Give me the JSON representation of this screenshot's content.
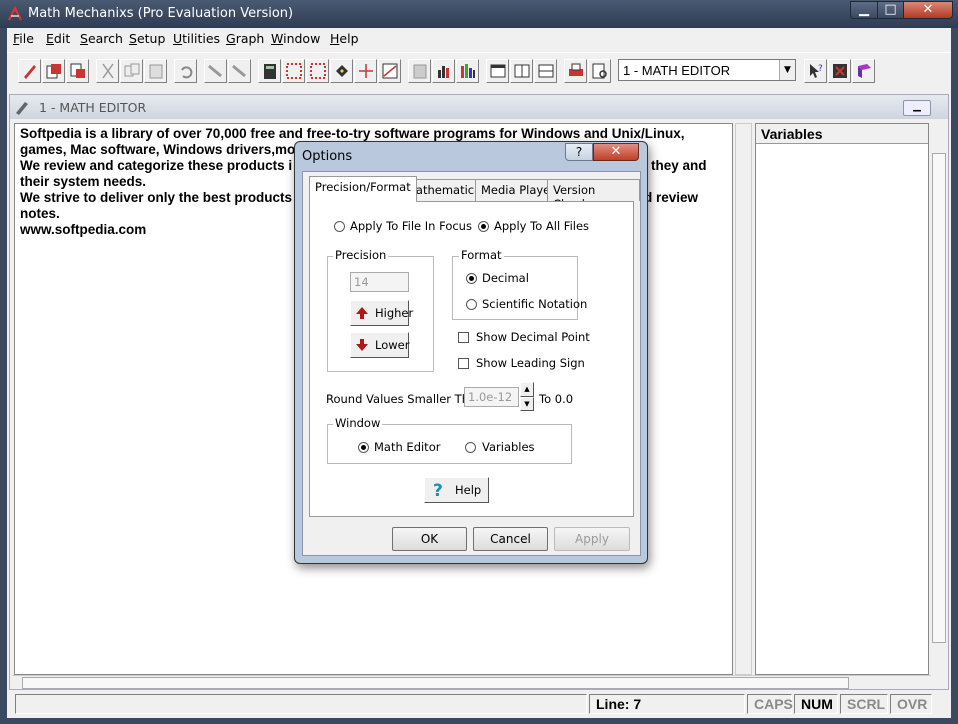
{
  "window": {
    "title": "Math Mechanixs (Pro Evaluation Version)"
  },
  "menu": [
    {
      "key": "F",
      "rest": "ile"
    },
    {
      "key": "E",
      "rest": "dit"
    },
    {
      "key": "S",
      "rest": "earch"
    },
    {
      "key": "S",
      "rest": "etup"
    },
    {
      "key": "U",
      "rest": "tilities"
    },
    {
      "key": "G",
      "rest": "raph"
    },
    {
      "key": "W",
      "rest": "indow"
    },
    {
      "key": "H",
      "rest": "elp"
    }
  ],
  "toolbar": {
    "document_select": "1 - MATH EDITOR"
  },
  "child": {
    "title": "1 - MATH EDITOR",
    "editor_lines": [
      "Softpedia is a library of over 70,000 free and free-to-try software programs for Windows and Unix/Linux,",
      "games, Mac software, Windows drivers,mo",
      "We review and categorize these products i",
      "their system needs.",
      "We strive to deliver only the best products",
      "notes.",
      "www.softpedia.com"
    ],
    "editor_right_fragments": [
      "they and",
      "d review"
    ],
    "variables_header": "Variables"
  },
  "status": {
    "line": "Line: 7",
    "caps": "CAPS",
    "num": "NUM",
    "scrl": "SCRL",
    "ovr": "OVR"
  },
  "dialog": {
    "title": "Options",
    "help_glyph": "?",
    "close_glyph": "✕",
    "tabs": [
      "Precision/Format",
      "Mathematical",
      "Media Player",
      "Version Check"
    ],
    "apply_scope": {
      "focus_label": "Apply To File In Focus",
      "all_label": "Apply To All Files",
      "selected": "all"
    },
    "precision": {
      "group_label": "Precision",
      "value": "14",
      "higher_label": "Higher",
      "lower_label": "Lower"
    },
    "format": {
      "group_label": "Format",
      "decimal_label": "Decimal",
      "sci_label": "Scientific Notation",
      "selected": "decimal"
    },
    "show_decimal_point": {
      "label": "Show Decimal Point",
      "checked": false
    },
    "show_leading_sign": {
      "label": "Show Leading Sign",
      "checked": false
    },
    "round": {
      "label": "Round Values Smaller Than",
      "value": "1.0e-12",
      "suffix": "To 0.0"
    },
    "window_group": {
      "group_label": "Window",
      "math_editor_label": "Math Editor",
      "variables_label": "Variables",
      "selected": "math_editor"
    },
    "help_button": "Help",
    "ok": "OK",
    "cancel": "Cancel",
    "apply": "Apply"
  },
  "colors": {
    "titlebar": "#2e3c52",
    "close": "#c0402a",
    "higher_arrow": "#b01818",
    "lower_arrow": "#b01818",
    "help_q": "#1a8fb0"
  }
}
